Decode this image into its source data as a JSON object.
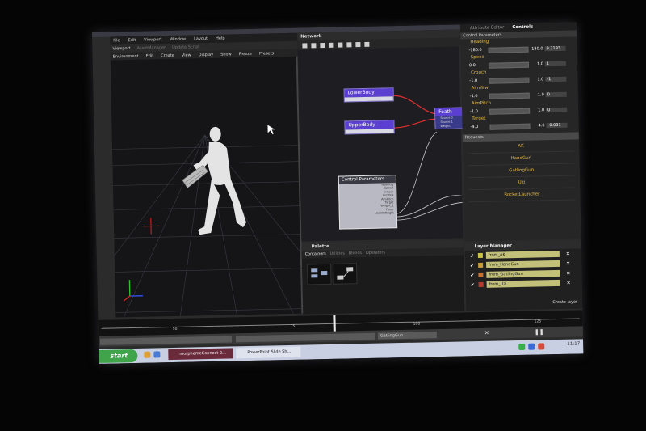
{
  "menubar": {
    "items": [
      "File",
      "Edit",
      "Viewport",
      "Window",
      "Layout",
      "Help"
    ]
  },
  "viewport": {
    "tabs": [
      "Viewport",
      "AssetManager",
      "Update Script"
    ],
    "menu": [
      "Environment",
      "Edit",
      "Create",
      "View",
      "Display",
      "Show",
      "Freeze",
      "Presets"
    ]
  },
  "network": {
    "title": "Network",
    "nodes": {
      "lower": "LowerBody",
      "upper": "UpperBody",
      "feather": "Feath"
    },
    "feather_ports": [
      "Source 0",
      "Source 1",
      "Weight"
    ],
    "control": {
      "title": "Control Parameters",
      "ports": [
        "Heading",
        "Speed",
        "Crouch",
        "AimYaw",
        "AimPitch",
        "Target",
        "Weight_1",
        "Timer",
        "UseAltWeight"
      ]
    }
  },
  "palette": {
    "title": "Palette",
    "tabs": [
      "Containers",
      "Utilities",
      "Blends",
      "Operators"
    ]
  },
  "attr": {
    "tabs": [
      "Attribute Editor",
      "Controls"
    ],
    "section": "Control Parameters",
    "params": [
      {
        "label": "Heading",
        "min": "-180.0",
        "max": "180.0",
        "cur": "9.2193"
      },
      {
        "label": "Speed",
        "min": "0.0",
        "max": "1.0",
        "cur": "1"
      },
      {
        "label": "Crouch",
        "min": "-1.0",
        "max": "1.0",
        "cur": "-1"
      },
      {
        "label": "AimYaw",
        "min": "-1.0",
        "max": "1.0",
        "cur": "0"
      },
      {
        "label": "AimPitch",
        "min": "-1.0",
        "max": "1.0",
        "cur": "0"
      },
      {
        "label": "Target",
        "min": "-4.0",
        "max": "4.0",
        "cur": "-0.031"
      }
    ],
    "requests_title": "Requests",
    "requests": [
      "AK",
      "HandGun",
      "GatlingGun",
      "Uzi",
      "RocketLauncher"
    ]
  },
  "layers": {
    "title": "Layer Manager",
    "rows": [
      {
        "name": "from_AK",
        "color": "#c8c24a"
      },
      {
        "name": "from_HandGun",
        "color": "#c89a3a"
      },
      {
        "name": "from_GatlingGun",
        "color": "#c8702e"
      },
      {
        "name": "from_Uzi",
        "color": "#b83a30"
      }
    ],
    "check": "✔",
    "close": "✕",
    "create": "Create layer"
  },
  "timeline": {
    "ticks": [
      "50",
      "75",
      "100",
      "125"
    ]
  },
  "status": {
    "field": "GatlingGun"
  },
  "taskbar": {
    "start": "start",
    "buttons": [
      "morphemeConnect 2...",
      "PowerPoint Slide Sh..."
    ],
    "clock": "11:17"
  },
  "colors": {
    "accent": "#5a3fd0",
    "param_label": "#e6b93a"
  }
}
